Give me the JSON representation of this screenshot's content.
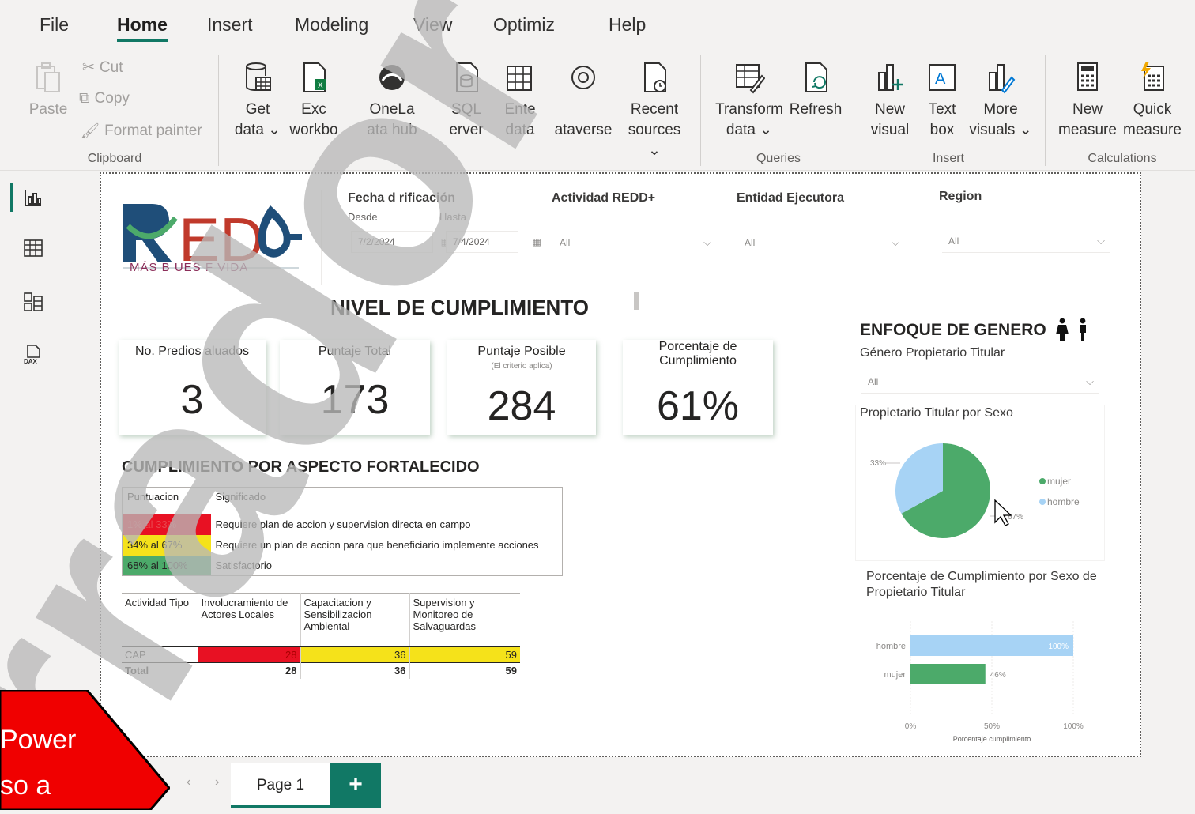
{
  "menu": {
    "tabs": [
      "File",
      "Home",
      "Insert",
      "Modeling",
      "View",
      "Optimiz",
      "Help"
    ]
  },
  "ribbon": {
    "paste": "Paste",
    "cut": "Cut",
    "copy": "Copy",
    "format_painter": "Format painter",
    "clipboard_label": "Clipboard",
    "get_data": [
      "Get",
      "data ⌄"
    ],
    "excel": [
      "Exc",
      "workbo"
    ],
    "onelake": [
      "OneLa",
      "ata hub"
    ],
    "sql": [
      "SQL",
      "erver"
    ],
    "enter": [
      "Ente",
      "data"
    ],
    "dataverse": [
      "",
      "ataverse"
    ],
    "recent": [
      "Recent",
      "sources ⌄"
    ],
    "transform": [
      "Transform",
      "data ⌄"
    ],
    "refresh": [
      "Refresh",
      ""
    ],
    "queries_label": "Queries",
    "new_visual": [
      "New",
      "visual"
    ],
    "text_box": [
      "Text",
      "box"
    ],
    "more_visuals": [
      "More",
      "visuals ⌄"
    ],
    "insert_label": "Insert",
    "new_measure": [
      "New",
      "measure"
    ],
    "quick_measure": [
      "Quick",
      "measure"
    ],
    "calculations_label": "Calculations"
  },
  "report": {
    "logo_text": "MÁS B   UES F    VIDA",
    "slicers": {
      "fecha_title": "Fecha d     rificación",
      "desde": "Desde",
      "hasta": "Hasta",
      "date_from": "7/2/2024",
      "date_to": "7/4/2024",
      "actividad_title": "Actividad REDD+",
      "entidad_title": "Entidad Ejecutora",
      "region_title": "Region",
      "all": "All"
    },
    "nivel_title": "NIVEL DE CUMPLIMIENTO",
    "kpis": [
      {
        "label": "No. Predios   aluados",
        "value": "3"
      },
      {
        "label": "Puntaje Total",
        "value": "173"
      },
      {
        "label": "Puntaje Posible",
        "sub": "(El criterio aplica)",
        "value": "284"
      },
      {
        "label": "Porcentaje de Cumplimiento",
        "value": "61%"
      }
    ],
    "aspecto_title": "CUMPLIMIENTO POR ASPECTO FORTALECIDO",
    "legend_table": {
      "headers": [
        "Puntuacion",
        "Significado"
      ],
      "rows": [
        {
          "range": "1% al 33%",
          "meaning": "Requiere plan de accion y supervision directa en campo",
          "color": "#e81123"
        },
        {
          "range": "34% al 67%",
          "meaning": "Requiere un plan de accion para que beneficiario implemente acciones",
          "color": "#f5e21a"
        },
        {
          "range": "68% al 100%",
          "meaning": "Satisfactorio",
          "color": "#4caa6a"
        }
      ]
    },
    "matrix": {
      "headers": [
        "Actividad Tipo",
        "Involucramiento de Actores Locales",
        "Capacitacion y Sensibilizacion Ambiental",
        "Supervision y Monitoreo de Salvaguardas"
      ],
      "rows": [
        {
          "label": "CAP",
          "values": [
            "28",
            "36",
            "59"
          ]
        },
        {
          "label": "Total",
          "values": [
            "28",
            "36",
            "59"
          ]
        }
      ]
    },
    "genero": {
      "title": "ENFOQUE DE GENERO",
      "slicer_title": "Género Propietario Titular",
      "slicer_value": "All",
      "pie_title": "Propietario Titular por Sexo",
      "bar_title": "Porcentaje de Cumplimiento por Sexo de Propietario Titular",
      "bar_xlabel": "Porcentaje cumplimiento"
    }
  },
  "chart_data": [
    {
      "type": "pie",
      "title": "Propietario Titular por Sexo",
      "categories": [
        "mujer",
        "hombre"
      ],
      "values": [
        67,
        33
      ],
      "value_labels": [
        "67%",
        "33%"
      ],
      "colors": [
        "#4caa6a",
        "#a7d3f5"
      ],
      "legend": "right"
    },
    {
      "type": "bar",
      "orientation": "horizontal",
      "title": "Porcentaje de Cumplimiento por Sexo de Propietario Titular",
      "categories": [
        "hombre",
        "mujer"
      ],
      "values": [
        100,
        46
      ],
      "value_labels": [
        "100%",
        "46%"
      ],
      "colors": [
        "#a7d3f5",
        "#4caa6a"
      ],
      "xlabel": "Porcentaje cumplimiento",
      "xlim": [
        0,
        100
      ],
      "xticks": [
        "0%",
        "50%",
        "100%"
      ]
    }
  ],
  "pages": {
    "tab": "Page 1",
    "add": "+"
  },
  "callout": {
    "line1": "Power",
    "line2": "so a"
  }
}
